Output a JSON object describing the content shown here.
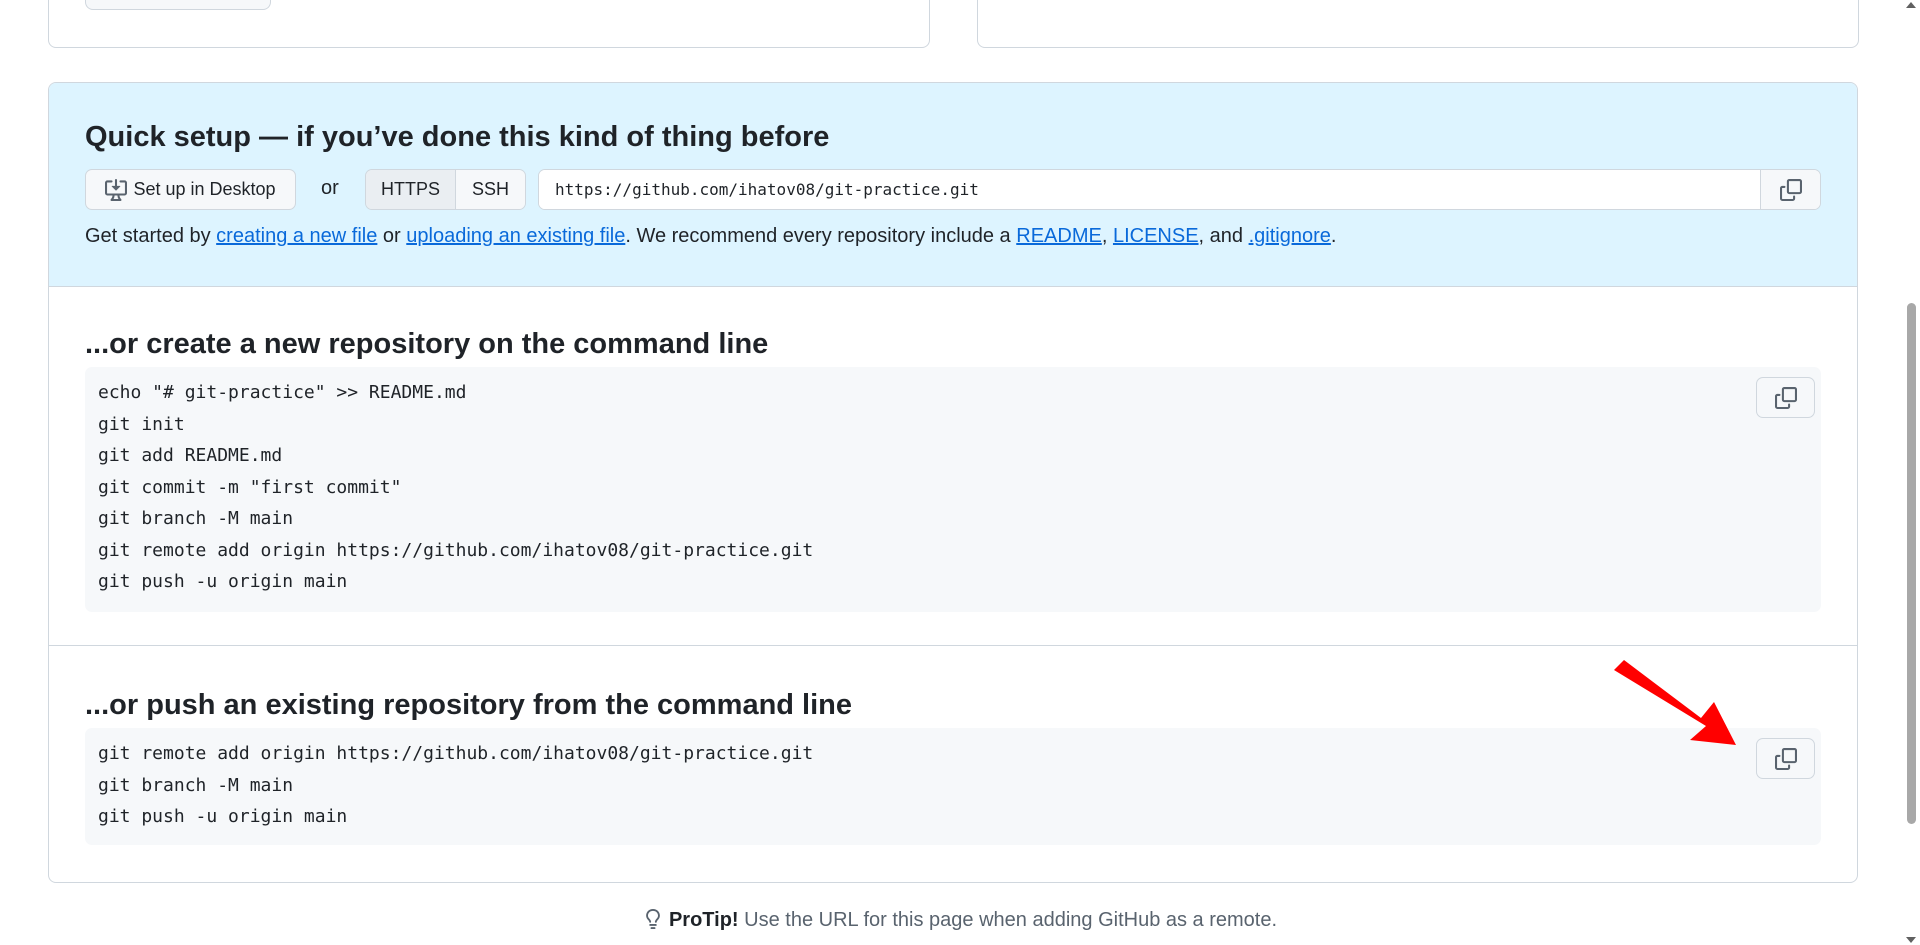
{
  "quick_setup": {
    "title": "Quick setup — if you’ve done this kind of thing before",
    "desktop_button_label": "Set up in Desktop",
    "or_text": "or",
    "protocol_https": "HTTPS",
    "protocol_ssh": "SSH",
    "selected_protocol": "HTTPS",
    "clone_url": "https://github.com/ihatov08/git-practice.git",
    "get_started": {
      "prefix": "Get started by ",
      "link_new_file": "creating a new file",
      "or": " or ",
      "link_upload": "uploading an existing file",
      "middle": ". We recommend every repository include a ",
      "link_readme": "README",
      "comma": ", ",
      "link_license": "LICENSE",
      "and": ", and ",
      "link_gitignore": ".gitignore",
      "suffix": "."
    }
  },
  "new_repo": {
    "title": "...or create a new repository on the command line",
    "lines": [
      "echo \"# git-practice\" >> README.md",
      "git init",
      "git add README.md",
      "git commit -m \"first commit\"",
      "git branch -M main",
      "git remote add origin https://github.com/ihatov08/git-practice.git",
      "git push -u origin main"
    ]
  },
  "push_existing": {
    "title": "...or push an existing repository from the command line",
    "lines": [
      "git remote add origin https://github.com/ihatov08/git-practice.git",
      "git branch -M main",
      "git push -u origin main"
    ]
  },
  "protip": {
    "label": "ProTip!",
    "text": " Use the URL for this page when adding GitHub as a remote."
  },
  "colors": {
    "quick_setup_bg": "#ddf4ff",
    "link": "#0969da",
    "annotation_arrow": "#ff0000"
  },
  "icons": {
    "desktop": "desktop-download-icon",
    "copy": "copy-icon",
    "protip": "light-bulb-icon"
  }
}
